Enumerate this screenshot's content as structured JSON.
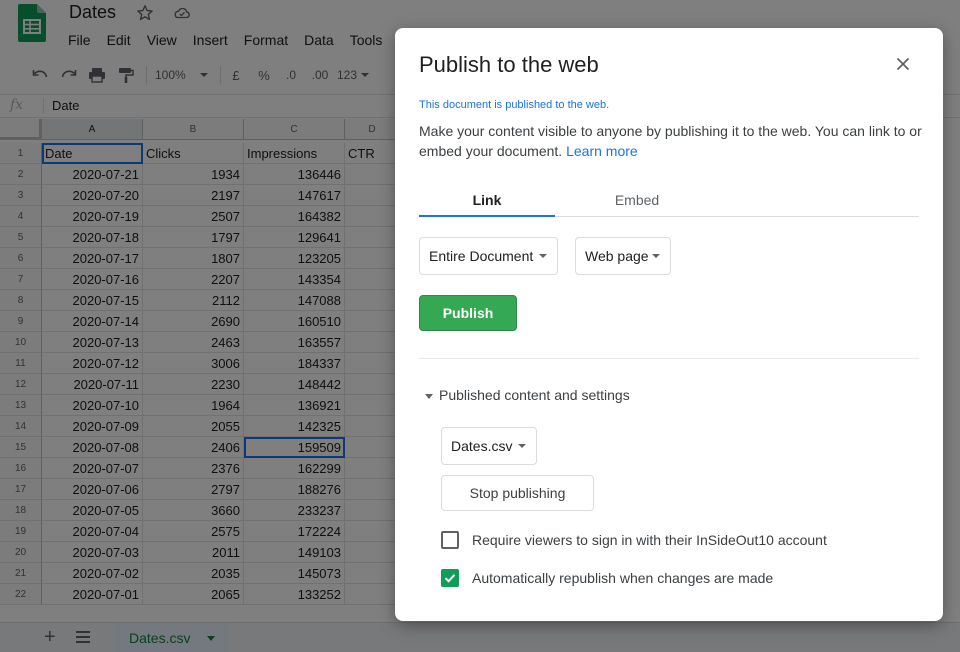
{
  "app": {
    "doc_title": "Dates",
    "menu": [
      "File",
      "Edit",
      "View",
      "Insert",
      "Format",
      "Data",
      "Tools"
    ],
    "toolbar": {
      "zoom": "100%",
      "currency": "£",
      "percent": "%",
      "dec_decrease": ".0",
      "dec_increase": ".00",
      "more_formats": "123"
    },
    "formula_bar": {
      "fx": "fx",
      "value": "Date"
    },
    "columns": [
      "A",
      "B",
      "C",
      "D"
    ],
    "header_row": [
      "Date",
      "Clicks",
      "Impressions",
      "CTR"
    ],
    "rows": [
      [
        "2020-07-21",
        "1934",
        "136446"
      ],
      [
        "2020-07-20",
        "2197",
        "147617"
      ],
      [
        "2020-07-19",
        "2507",
        "164382"
      ],
      [
        "2020-07-18",
        "1797",
        "129641"
      ],
      [
        "2020-07-17",
        "1807",
        "123205"
      ],
      [
        "2020-07-16",
        "2207",
        "143354"
      ],
      [
        "2020-07-15",
        "2112",
        "147088"
      ],
      [
        "2020-07-14",
        "2690",
        "160510"
      ],
      [
        "2020-07-13",
        "2463",
        "163557"
      ],
      [
        "2020-07-12",
        "3006",
        "184337"
      ],
      [
        "2020-07-11",
        "2230",
        "148442"
      ],
      [
        "2020-07-10",
        "1964",
        "136921"
      ],
      [
        "2020-07-09",
        "2055",
        "142325"
      ],
      [
        "2020-07-08",
        "2406",
        "159509"
      ],
      [
        "2020-07-07",
        "2376",
        "162299"
      ],
      [
        "2020-07-06",
        "2797",
        "188276"
      ],
      [
        "2020-07-05",
        "3660",
        "233237"
      ],
      [
        "2020-07-04",
        "2575",
        "172224"
      ],
      [
        "2020-07-03",
        "2011",
        "149103"
      ],
      [
        "2020-07-02",
        "2035",
        "145073"
      ],
      [
        "2020-07-01",
        "2065",
        "133252"
      ]
    ],
    "sheet_tab": "Dates.csv"
  },
  "dialog": {
    "title": "Publish to the web",
    "status": "This document is published to the web.",
    "description": "Make your content visible to anyone by publishing it to the web. You can link to or embed your document.",
    "learn_more": "Learn more",
    "tabs": [
      "Link",
      "Embed"
    ],
    "scope_select": "Entire Document",
    "format_select": "Web page",
    "publish_label": "Publish",
    "section_label": "Published content and settings",
    "content_select": "Dates.csv",
    "stop_label": "Stop publishing",
    "require_signin_label": "Require viewers to sign in with their InSideOut10 account",
    "require_signin_checked": false,
    "auto_republish_label": "Automatically republish when changes are made",
    "auto_republish_checked": true
  },
  "colors": {
    "accent": "#1a73e8",
    "publish_green": "#34a853",
    "check_green": "#0f9d58",
    "sheets_green": "#188038"
  }
}
